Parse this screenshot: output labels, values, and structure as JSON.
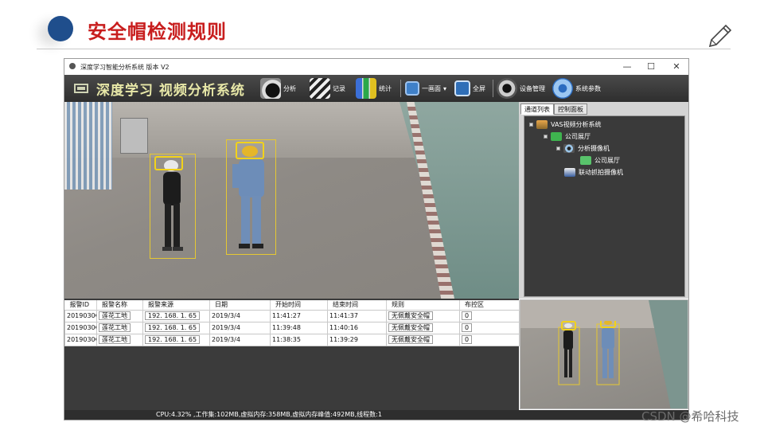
{
  "slide": {
    "title": "安全帽检测规则"
  },
  "window": {
    "title": "深度学习智能分析系统 版本 V2",
    "controls": {
      "minimize": "—",
      "maximize": "☐",
      "close": "✕"
    }
  },
  "toolbar": {
    "logo_text": "深度学习 视频分析系统",
    "items": [
      {
        "label": "分析",
        "icon": "analysis-play-icon"
      },
      {
        "label": "记录",
        "icon": "clapper-icon"
      },
      {
        "label": "统计",
        "icon": "bar-chart-icon"
      },
      {
        "label": "一画面",
        "icon": "single-screen-icon"
      },
      {
        "label": "全屏",
        "icon": "fullscreen-icon"
      },
      {
        "label": "设备管理",
        "icon": "camera-device-icon"
      },
      {
        "label": "系统参数",
        "icon": "gear-icon"
      }
    ]
  },
  "panel": {
    "tabs": [
      "通道列表",
      "控制面板"
    ],
    "tree": [
      {
        "label": "VAS视频分析系统",
        "level": 0
      },
      {
        "label": "公司展厅",
        "level": 1
      },
      {
        "label": "分析摄像机",
        "level": 2
      },
      {
        "label": "公司展厅",
        "level": 3
      },
      {
        "label": "联动抓拍摄像机",
        "level": 2
      }
    ]
  },
  "alarm_table": {
    "columns": [
      "报警ID",
      "报警名称",
      "报警来源",
      "日期",
      "开始时间",
      "结束时间",
      "规则",
      "布控区"
    ],
    "rows": [
      [
        "2019030€",
        "莲花工地",
        "192. 168. 1. 65",
        "2019/3/4",
        "11:41:27",
        "11:41:37",
        "无佩戴安全帽",
        "0"
      ],
      [
        "2019030€",
        "莲花工地",
        "192. 168. 1. 65",
        "2019/3/4",
        "11:39:48",
        "11:40:16",
        "无佩戴安全帽",
        "0"
      ],
      [
        "2019030€",
        "莲花工地",
        "192. 168. 1. 65",
        "2019/3/4",
        "11:38:35",
        "11:39:29",
        "无佩戴安全帽",
        "0"
      ]
    ]
  },
  "status": {
    "text": "CPU:4.32% ,工作集:102MB,虚拟内存:358MB,虚拟内存峰值:492MB,线程数:1"
  },
  "watermark": "CSDN @希哈科技",
  "colors": {
    "title_red": "#c81e1e",
    "dot_blue": "#1f4e8c",
    "detect_yellow": "#f2d21a",
    "toolbar_dark": "#3a3a3a"
  }
}
